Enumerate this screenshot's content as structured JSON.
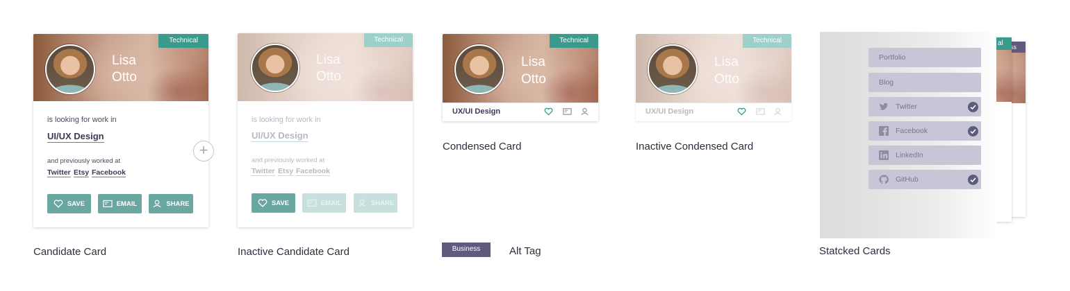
{
  "candidate_card": {
    "tag": "Technical",
    "first_name": "Lisa",
    "last_name": "Otto",
    "looking_text": "is looking for work in",
    "field": "UI/UX Design",
    "previously_text": "and previously worked at",
    "companies": [
      "Twitter",
      "Etsy",
      "Facebook"
    ],
    "buttons": {
      "save": "SAVE",
      "email": "EMAIL",
      "share": "SHARE"
    },
    "caption": "Candidate Card"
  },
  "inactive_candidate_card": {
    "tag": "Technical",
    "first_name": "Lisa",
    "last_name": "Otto",
    "looking_text": "is looking for work in",
    "field": "UI/UX Design",
    "previously_text": "and previously worked at",
    "companies": [
      "Twitter",
      "Etsy",
      "Facebook"
    ],
    "buttons": {
      "save": "SAVE",
      "email": "EMAIL",
      "share": "SHARE"
    },
    "caption": "Inactive Candidate Card"
  },
  "condensed_card": {
    "tag": "Technical",
    "first_name": "Lisa",
    "last_name": "Otto",
    "field": "UX/UI Design",
    "caption": "Condensed Card"
  },
  "inactive_condensed_card": {
    "tag": "Technical",
    "first_name": "Lisa",
    "last_name": "Otto",
    "field": "UX/UI Design",
    "caption": "Inactive Condensed Card"
  },
  "alt_tag": {
    "tag": "Business",
    "caption": "Alt Tag"
  },
  "stacked_cards": {
    "partial_tags": [
      "al",
      "ss"
    ],
    "links": [
      {
        "label": "Portfolio",
        "icon": "",
        "checked": false
      },
      {
        "label": "Blog",
        "icon": "",
        "checked": false
      },
      {
        "label": "Twitter",
        "icon": "twitter-icon",
        "checked": true
      },
      {
        "label": "Facebook",
        "icon": "facebook-icon",
        "checked": true
      },
      {
        "label": "LinkedIn",
        "icon": "linkedin-icon",
        "checked": false
      },
      {
        "label": "GitHub",
        "icon": "github-icon",
        "checked": true
      }
    ],
    "caption": "Statcked Cards"
  },
  "colors": {
    "accent": "#3a9a8e",
    "button": "#6aa7a0",
    "business": "#625a7e",
    "pill": "#c7c6d6",
    "check": "#5e5c7c"
  }
}
